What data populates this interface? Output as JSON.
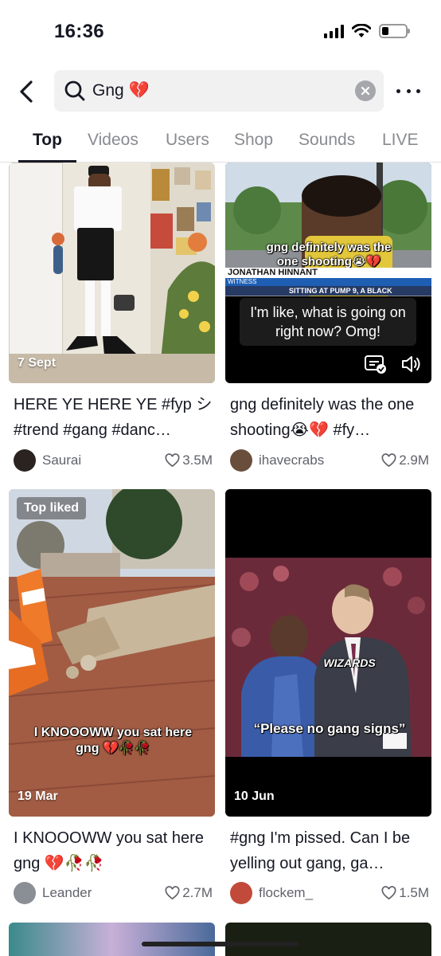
{
  "status_bar": {
    "time": "16:36"
  },
  "search": {
    "query": "Gng 💔"
  },
  "tabs": [
    "Top",
    "Videos",
    "Users",
    "Shop",
    "Sounds",
    "LIVE"
  ],
  "results": [
    {
      "date": "7 Sept",
      "caption": "HERE YE HERE YE #fyp シ #trend #gang #danc…",
      "username": "Saurai",
      "likes": "3.5M"
    },
    {
      "caption": "gng definitely was the one shooting😭💔 #fy…",
      "username": "ihavecrabs",
      "likes": "2.9M",
      "overlay_caption": "gng definitely was the one shooting😭💔",
      "lower_third_name": "JONATHAN HINNANT",
      "lower_third_title": "WITNESS",
      "lower_third_ticker": "SITTING AT PUMP 9, A BLACK",
      "subtitle": "I'm like, what is going on right now? Omg!"
    },
    {
      "badge": "Top liked",
      "date": "19 Mar",
      "overlay_text": "I KNOOOWW you sat here gng 💔🥀🥀",
      "caption": "I KNOOOWW you sat here gng 💔🥀🥀",
      "username": "Leander",
      "likes": "2.7M"
    },
    {
      "date": "10 Jun",
      "overlay_text": "“Please no gang signs”",
      "jersey_text": "WIZARDS",
      "caption": "#gng I'm pissed. Can I be yelling out gang, ga…",
      "username": "flockem_",
      "likes": "1.5M"
    }
  ],
  "colors": {
    "text": "#161823",
    "secondary": "#8a8b91",
    "search_bg": "#f1f1f2"
  }
}
